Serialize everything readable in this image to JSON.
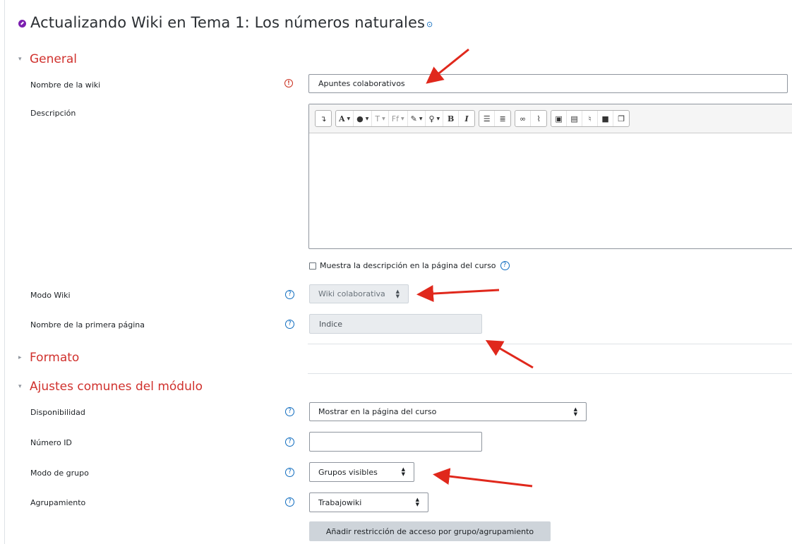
{
  "page": {
    "title": "Actualizando Wiki en Tema 1: Los números naturales"
  },
  "sections": {
    "general": "General",
    "formato": "Formato",
    "ajustes": "Ajustes comunes del módulo"
  },
  "fields": {
    "nombre_wiki": {
      "label": "Nombre de la wiki",
      "value": "Apuntes colaborativos"
    },
    "descripcion": {
      "label": "Descripción"
    },
    "muestra_descripcion": {
      "label": "Muestra la descripción en la página del curso",
      "checked": false
    },
    "modo_wiki": {
      "label": "Modo Wiki",
      "value": "Wiki colaborativa"
    },
    "primera_pagina": {
      "label": "Nombre de la primera página",
      "value": "Indice"
    },
    "disponibilidad": {
      "label": "Disponibilidad",
      "value": "Mostrar en la página del curso"
    },
    "numero_id": {
      "label": "Número ID",
      "value": ""
    },
    "modo_grupo": {
      "label": "Modo de grupo",
      "value": "Grupos visibles"
    },
    "agrupamiento": {
      "label": "Agrupamiento",
      "value": "Trabajowiki"
    },
    "restriccion_button": "Añadir restricción de acceso por grupo/agrupamiento"
  },
  "editor_toolbar": {
    "undo": "↴",
    "font_color": "A",
    "highlight": "💧",
    "text_format": "T",
    "font_family": "Ff",
    "brush": "🖌",
    "lightbulb": "💡",
    "bold": "B",
    "italic": "I",
    "ul": "☰",
    "ol": "☷",
    "link": "🔗",
    "unlink": "⛓",
    "image": "🖼",
    "media": "▣",
    "record_audio": "🎙",
    "record_video": "■",
    "manage_files": "❐"
  },
  "icons": {
    "help": "?",
    "required": "!",
    "expanded": "▾",
    "collapsed": "▸",
    "select_arrows": "▲▼"
  },
  "colors": {
    "section_title": "#d0312d",
    "help_icon": "#0f6cbf",
    "module_icon": "#7c1fb0",
    "annotation_arrow": "#e0281c"
  }
}
